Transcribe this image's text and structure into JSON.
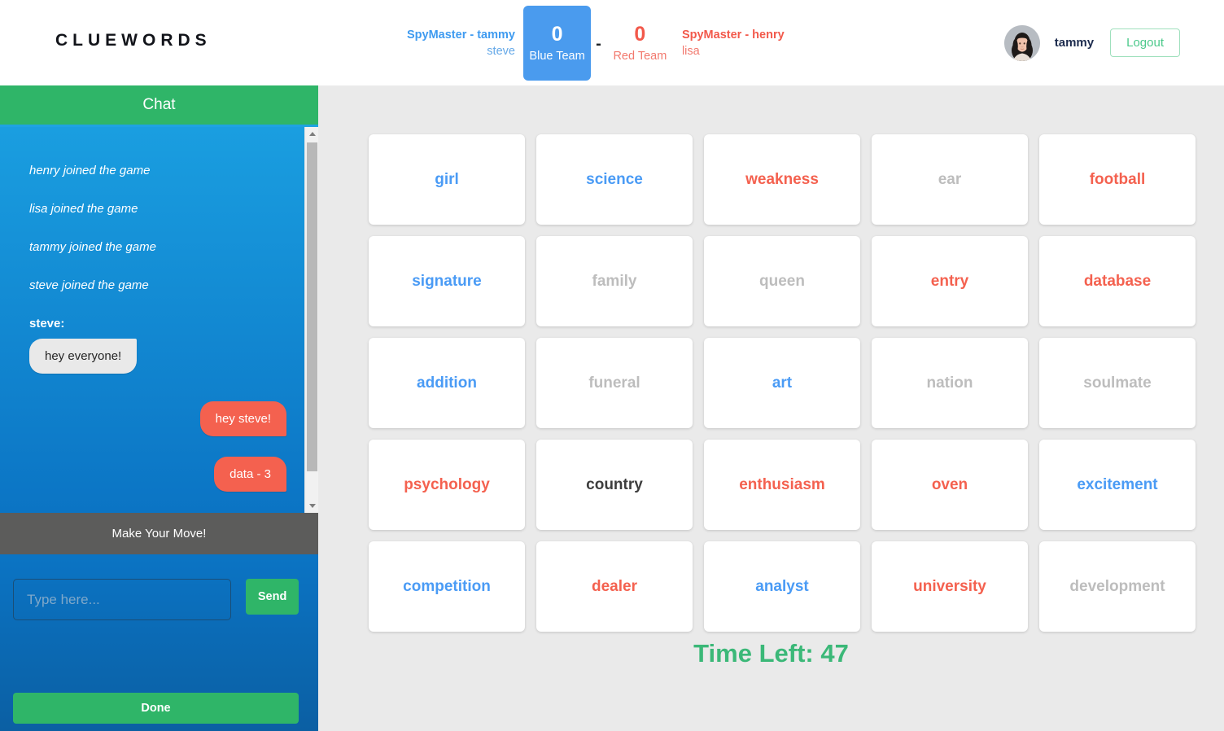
{
  "header": {
    "brand": "CLUEWORDS",
    "blue_team": {
      "spymaster_label": "SpyMaster - tammy",
      "member": "steve",
      "score": "0",
      "team_label": "Blue Team",
      "color": "#4a9bee"
    },
    "separator": "-",
    "red_team": {
      "spymaster_label": "SpyMaster - henry",
      "member": "lisa",
      "score": "0",
      "team_label": "Red Team",
      "color": "#f2594b"
    },
    "user": {
      "avatar_icon": "user-avatar-photo",
      "username": "tammy",
      "logout_label": "Logout"
    }
  },
  "sidebar": {
    "chat_title": "Chat",
    "system_messages": [
      "henry joined the game",
      "lisa joined the game",
      "tammy joined the game",
      "steve joined the game"
    ],
    "conversation": [
      {
        "author": "steve:",
        "text": "hey everyone!",
        "side": "in"
      },
      {
        "author": "",
        "text": "hey steve!",
        "side": "out"
      },
      {
        "author": "",
        "text": "data - 3",
        "side": "out"
      }
    ],
    "move_banner": "Make Your Move!",
    "input_placeholder": "Type here...",
    "input_value": "",
    "send_label": "Send",
    "done_label": "Done",
    "scrollbar": {
      "up_icon": "chevron-up-icon",
      "down_icon": "chevron-down-icon"
    }
  },
  "board": {
    "cards": [
      {
        "word": "girl",
        "type": "blue"
      },
      {
        "word": "science",
        "type": "blue"
      },
      {
        "word": "weakness",
        "type": "red"
      },
      {
        "word": "ear",
        "type": "neutral"
      },
      {
        "word": "football",
        "type": "red"
      },
      {
        "word": "signature",
        "type": "blue"
      },
      {
        "word": "family",
        "type": "neutral"
      },
      {
        "word": "queen",
        "type": "neutral"
      },
      {
        "word": "entry",
        "type": "red"
      },
      {
        "word": "database",
        "type": "red"
      },
      {
        "word": "addition",
        "type": "blue"
      },
      {
        "word": "funeral",
        "type": "neutral"
      },
      {
        "word": "art",
        "type": "blue"
      },
      {
        "word": "nation",
        "type": "neutral"
      },
      {
        "word": "soulmate",
        "type": "neutral"
      },
      {
        "word": "psychology",
        "type": "red"
      },
      {
        "word": "country",
        "type": "black"
      },
      {
        "word": "enthusiasm",
        "type": "red"
      },
      {
        "word": "oven",
        "type": "red"
      },
      {
        "word": "excitement",
        "type": "blue"
      },
      {
        "word": "competition",
        "type": "blue"
      },
      {
        "word": "dealer",
        "type": "red"
      },
      {
        "word": "analyst",
        "type": "blue"
      },
      {
        "word": "university",
        "type": "red"
      },
      {
        "word": "development",
        "type": "neutral"
      }
    ],
    "timer": "Time Left: 47",
    "timer_color": "#3bb878"
  }
}
